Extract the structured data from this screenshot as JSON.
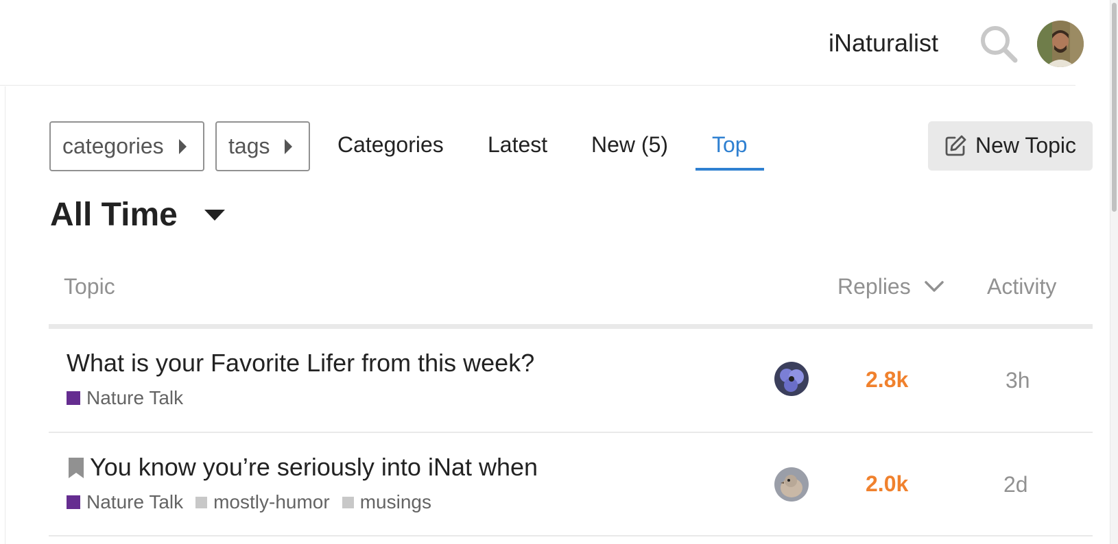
{
  "header": {
    "site_name": "iNaturalist",
    "search_icon": "search-icon",
    "avatar_icon": "user-avatar"
  },
  "nav": {
    "categories_dropdown": "categories",
    "tags_dropdown": "tags",
    "links": [
      "Categories",
      "Latest",
      "New (5)",
      "Top"
    ],
    "active": "Top",
    "new_topic_label": "New Topic",
    "accent_color": "#2f80d1"
  },
  "period": {
    "title": "All Time"
  },
  "table": {
    "headers": {
      "topic": "Topic",
      "replies": "Replies",
      "activity": "Activity"
    },
    "rows": [
      {
        "title": "What is your Favorite Lifer from this week?",
        "pinned": false,
        "category": "Nature Talk",
        "tags": [],
        "replies": "2.8k",
        "activity": "3h"
      },
      {
        "title": "You know you’re seriously into iNat when",
        "pinned": true,
        "category": "Nature Talk",
        "tags": [
          "mostly-humor",
          "musings"
        ],
        "replies": "2.0k",
        "activity": "2d"
      }
    ]
  },
  "colors": {
    "category": "#652d90",
    "replies_hot": "#f0812d"
  }
}
